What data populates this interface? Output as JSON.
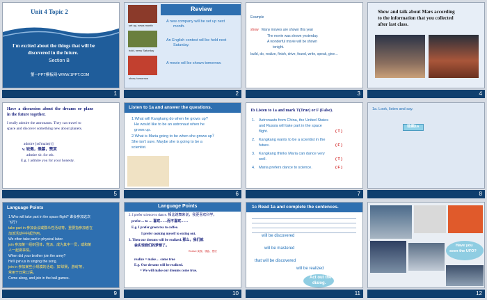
{
  "slides": [
    {
      "num": "1",
      "title": "Unit 4 Topic 2",
      "subtitle_lines": [
        "I'm excited about the things that will be",
        "discovered in the future."
      ],
      "section": "Section B",
      "footer": "第一PPT模板网-WWW.1PPT.COM"
    },
    {
      "num": "2",
      "header": "Review",
      "captions": [
        "set up, news month",
        "hold, news Saturday",
        "show, tomorrow"
      ],
      "sentences": [
        [
          "A new company will be set up next",
          "month."
        ],
        [
          "An English contest will be held next",
          "Saturday."
        ],
        [
          "A movie will be shown tomorrow."
        ]
      ]
    },
    {
      "num": "3",
      "example_label": "Example",
      "show_word": "show",
      "lines": [
        "Many movies are shown this year",
        "The movie was shown yesterday.",
        "A wonderful movie will be shown",
        "tonight."
      ],
      "words": "build, do, realize, finish, drive, found, write, speak, give…"
    },
    {
      "num": "4",
      "title_lines": [
        "Show and talk about Mars according",
        "to the information that you collected",
        "after last class."
      ]
    },
    {
      "num": "5",
      "title_lines": [
        "Have  a  discussion  about  the  dreams  or  plans",
        "in the future together."
      ],
      "bullet_lines": [
        "I really admire the astronauts. They can travel to",
        "space and discover something new about planets."
      ],
      "vocab": [
        "admire [əd'maiə(r)]",
        "v. 钦佩，羡慕，赞赏",
        "admire sb. for sth.",
        "E.g. I admire you for your honesty."
      ]
    },
    {
      "num": "6",
      "header": "Listen to 1a and answer the questions.",
      "lines": [
        "1.What will Kangkang do when he grows up?",
        "He would like to be an astronaut when he",
        "grows up.",
        "2.What is Maria going to be when she grows up？",
        "She isn't sure. Maybe she is going to be a",
        "scientist."
      ]
    },
    {
      "num": "7",
      "title": "1b Listen to 1a and mark T(True) or F (False).",
      "items": [
        {
          "n": "1.",
          "lines": [
            "Astronauts from China, the United States",
            "and Russia will take part in the space",
            "flight."
          ],
          "mark": "( T )"
        },
        {
          "n": "2.",
          "lines": [
            "Kangkang wants to be a scientist in the",
            "future."
          ],
          "mark": "( F )"
        },
        {
          "n": "3.",
          "lines": [
            "Kangkang thinks Maria can dance very",
            "well."
          ],
          "mark": "( T )"
        },
        {
          "n": "4.",
          "lines": [
            "Maria prefers dance to science."
          ],
          "mark": "( F )"
        }
      ]
    },
    {
      "num": "8",
      "header": "1a. Look, listen and say.",
      "button": "动画1a"
    },
    {
      "num": "9",
      "header": "Language Points",
      "lines": [
        "1.Who will take part in the space flight? 谁会参加这次",
        "飞行？",
        "take part in 参加会议或群众性活动等，重要指参加者在",
        "加该活动中并起作用。",
        "We often take part in physical labor.",
        "join 参加某一组织团体，党派，成为其中一员，或和某",
        "人一起做事情。",
        "When did your brother join the army?",
        "He'll join us in singing the song.",
        "join in 参加某些小规模的活动，如'球赛，游戏'等，",
        "常用于日常口语。",
        "Come along, and join in the ball games."
      ]
    },
    {
      "num": "10",
      "header": "Language Points",
      "lines": [
        "2. I prefer science to dance. 相比跳舞来说，我更喜欢科学。",
        "prefer… to … 喜欢……而不喜欢……",
        "E.g. I prefer green tea to coffee.",
        "I prefer cooking myself to eating out.",
        "3. Then our dreams will be realized. 那么，我们就",
        "会实现我们的梦想了。",
        "realize = make… come true",
        "E.g. Our dreams will be realized.",
        "= We will make our dreams come true."
      ],
      "note": "Realize 实现、领会、意识"
    },
    {
      "num": "11",
      "header": "1c Read 1a and complete the sentences.",
      "answers": [
        "will be discovered",
        "will be mastered",
        "that will be discovered",
        "will be realized"
      ],
      "bubble_lines": [
        "Act out the",
        "dialog."
      ]
    },
    {
      "num": "12",
      "bubble_lines": [
        "Have you",
        "seen the UFO?"
      ]
    }
  ]
}
